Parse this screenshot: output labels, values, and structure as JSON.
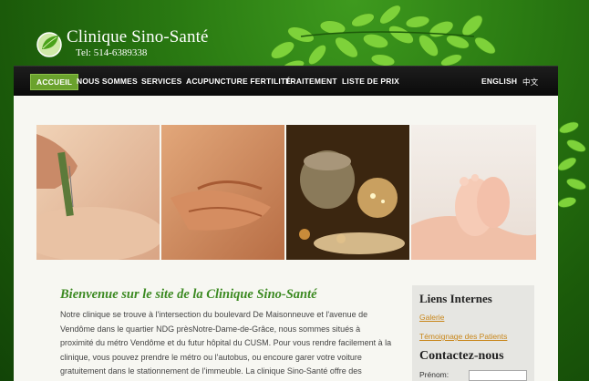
{
  "header": {
    "title": "Clinique Sino-Santé",
    "phone": "Tel: 514-6389338"
  },
  "nav": {
    "items": [
      "ACCUEIL",
      "NOUS SOMMES",
      "SERVICES",
      "ACUPUNCTURE FERTILITÉ",
      "TRAITEMENT",
      "LISTE DE PRIX"
    ],
    "lang_english": "ENGLISH",
    "lang_chinese": "中文"
  },
  "main": {
    "heading": "Bienvenue sur le site de la Clinique Sino-Santé",
    "intro": "Notre clinique se trouve à l'intersection du boulevard De Maisonneuve et l'avenue de Vendôme dans le quartier NDG prèsNotre-Dame-de-Grâce, nous sommes situés à proximité du métro Vendôme et du futur hôpital du CUSM. Pour vous rendre facilement à la clinique, vous pouvez prendre le métro ou l'autobus, ou encoure garer votre voiture gratuitement dans le stationnement de l'immeuble. La clinique Sino-Santé offre des"
  },
  "sidebar": {
    "links_title": "Liens Internes",
    "link_gallery": "Galerie",
    "link_testimonials": "Témoignage des Patients",
    "contact_title": "Contactez-nous",
    "first_name_label": "Prénom:"
  },
  "colors": {
    "background_green": "#2a7a12",
    "nav_active": "#6aa22d",
    "heading_green": "#3c8a22",
    "link_orange": "#c8861a"
  }
}
